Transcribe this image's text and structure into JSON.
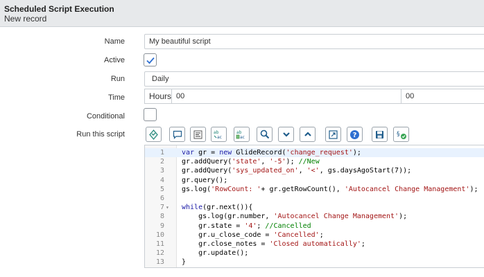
{
  "header": {
    "title": "Scheduled Script Execution",
    "subtitle": "New record"
  },
  "form": {
    "name_label": "Name",
    "name_value": "My beautiful script",
    "active_label": "Active",
    "active_checked": true,
    "run_label": "Run",
    "run_value": "Daily",
    "time_label": "Time",
    "time_hours_label": "Hours",
    "time_hours_value": "00",
    "time_minutes_value": "00",
    "conditional_label": "Conditional",
    "conditional_checked": false,
    "script_label": "Run this script"
  },
  "toolbar": {
    "buttons": [
      "script-include-icon",
      "comment-icon",
      "format-code-icon",
      "replace-icon",
      "replace-all-icon",
      "search-icon",
      "collapse-icon",
      "expand-icon",
      "fullscreen-icon",
      "help-icon",
      "save-icon",
      "syntax-check-icon"
    ]
  },
  "editor": {
    "lines": [
      {
        "n": "1",
        "fold": "",
        "code": "var gr = new GlideRecord('change_request');"
      },
      {
        "n": "2",
        "fold": "",
        "code": "gr.addQuery('state', '-5'); //New"
      },
      {
        "n": "3",
        "fold": "",
        "code": "gr.addQuery('sys_updated_on', '<', gs.daysAgoStart(7));"
      },
      {
        "n": "4",
        "fold": "",
        "code": "gr.query();"
      },
      {
        "n": "5",
        "fold": "",
        "code": "gs.log('RowCount: '+ gr.getRowCount(), 'Autocancel Change Management');"
      },
      {
        "n": "6",
        "fold": "",
        "code": ""
      },
      {
        "n": "7",
        "fold": "▾",
        "code": "while(gr.next()){"
      },
      {
        "n": "8",
        "fold": "",
        "code": "    gs.log(gr.number, 'Autocancel Change Management');"
      },
      {
        "n": "9",
        "fold": "",
        "code": "    gr.state = '4'; //Cancelled"
      },
      {
        "n": "10",
        "fold": "",
        "code": "    gr.u_close_code = 'Cancelled';"
      },
      {
        "n": "11",
        "fold": "",
        "code": "    gr.close_notes = 'Closed automatically';"
      },
      {
        "n": "12",
        "fold": "",
        "code": "    gr.update();"
      },
      {
        "n": "13",
        "fold": "",
        "code": "}"
      }
    ]
  },
  "colors": {
    "accent": "#1f8476",
    "check": "#2e6fd1",
    "header_bg": "#e7e9eb"
  }
}
